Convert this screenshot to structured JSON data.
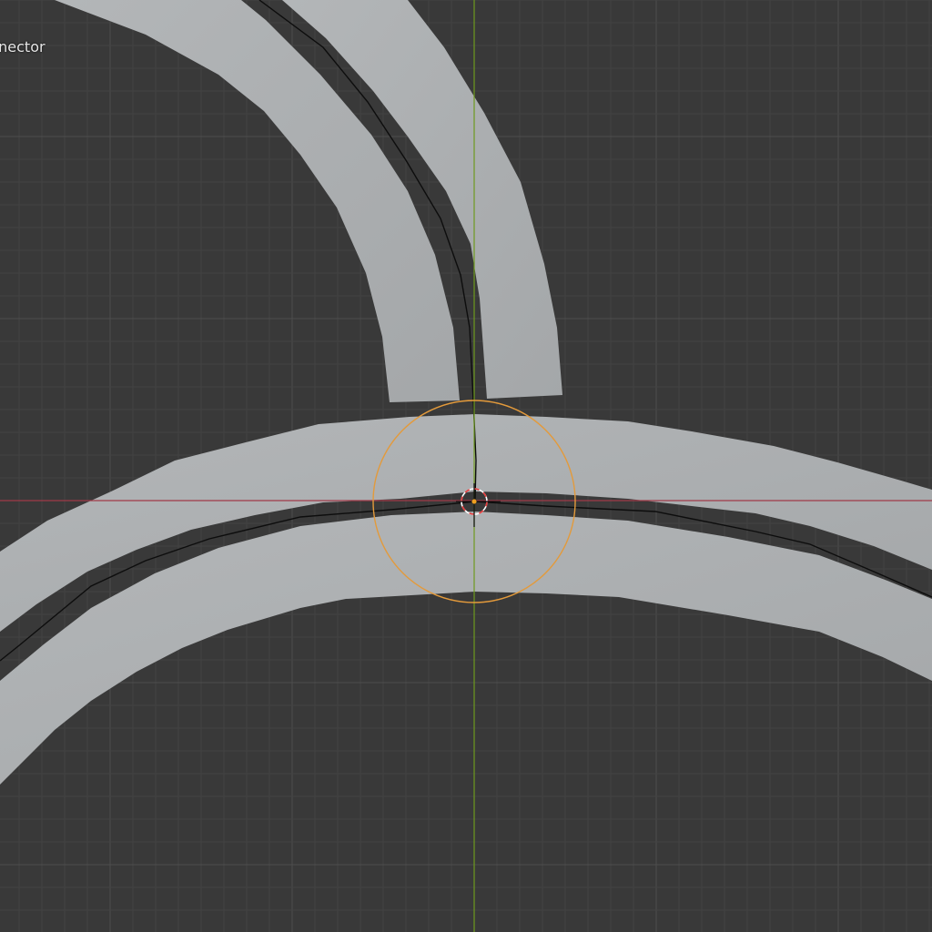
{
  "viewport": {
    "object_label": "nnector",
    "colors": {
      "background": "#393939",
      "grid_minor": "#434343",
      "grid_major": "#4d4d4d",
      "x_axis": "#a03a48",
      "y_axis": "#6e9a1e",
      "mesh_face": "#aeb1b3",
      "curve": "#0d0d0d",
      "selection_outline": "#e39a3b",
      "cursor_red": "#e53b3b",
      "cursor_white": "#ffffff",
      "origin_dot": "#f0a020"
    },
    "icons": {
      "origin": "origin-dot-icon",
      "cursor": "3d-cursor-icon",
      "selection": "selection-circle-icon"
    }
  }
}
